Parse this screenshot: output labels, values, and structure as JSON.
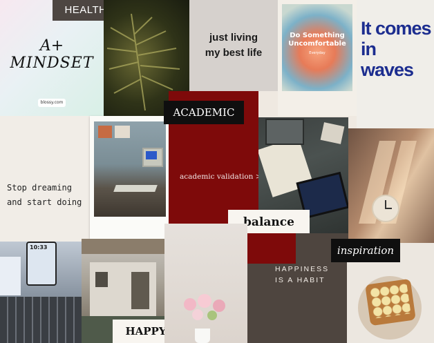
{
  "labels": {
    "health": "HEALTH",
    "mindset_line1": "A+",
    "mindset_line2": "MINDSET",
    "mindset_site": "blossy.com",
    "just_living": "just living my best life",
    "do_something": "Do Something Uncomfortable",
    "do_something_sub": "Everyday",
    "it_comes": "It comes in waves",
    "academic": "ACADEMIC",
    "academic_validation": "academic validation >",
    "stop_dreaming": "Stop dreaming and start doing",
    "balance": "balance",
    "inspiration": "inspiration",
    "happiness": "HAPPINESS IS A HABIT",
    "happy": "HAPPY",
    "phone_time": "10:33"
  },
  "colors": {
    "accent_red": "#7e0a0a",
    "dark_brown": "#4e453f",
    "black_label": "#111111",
    "navy_text": "#1c2d8f",
    "cream": "#f3efe8"
  }
}
